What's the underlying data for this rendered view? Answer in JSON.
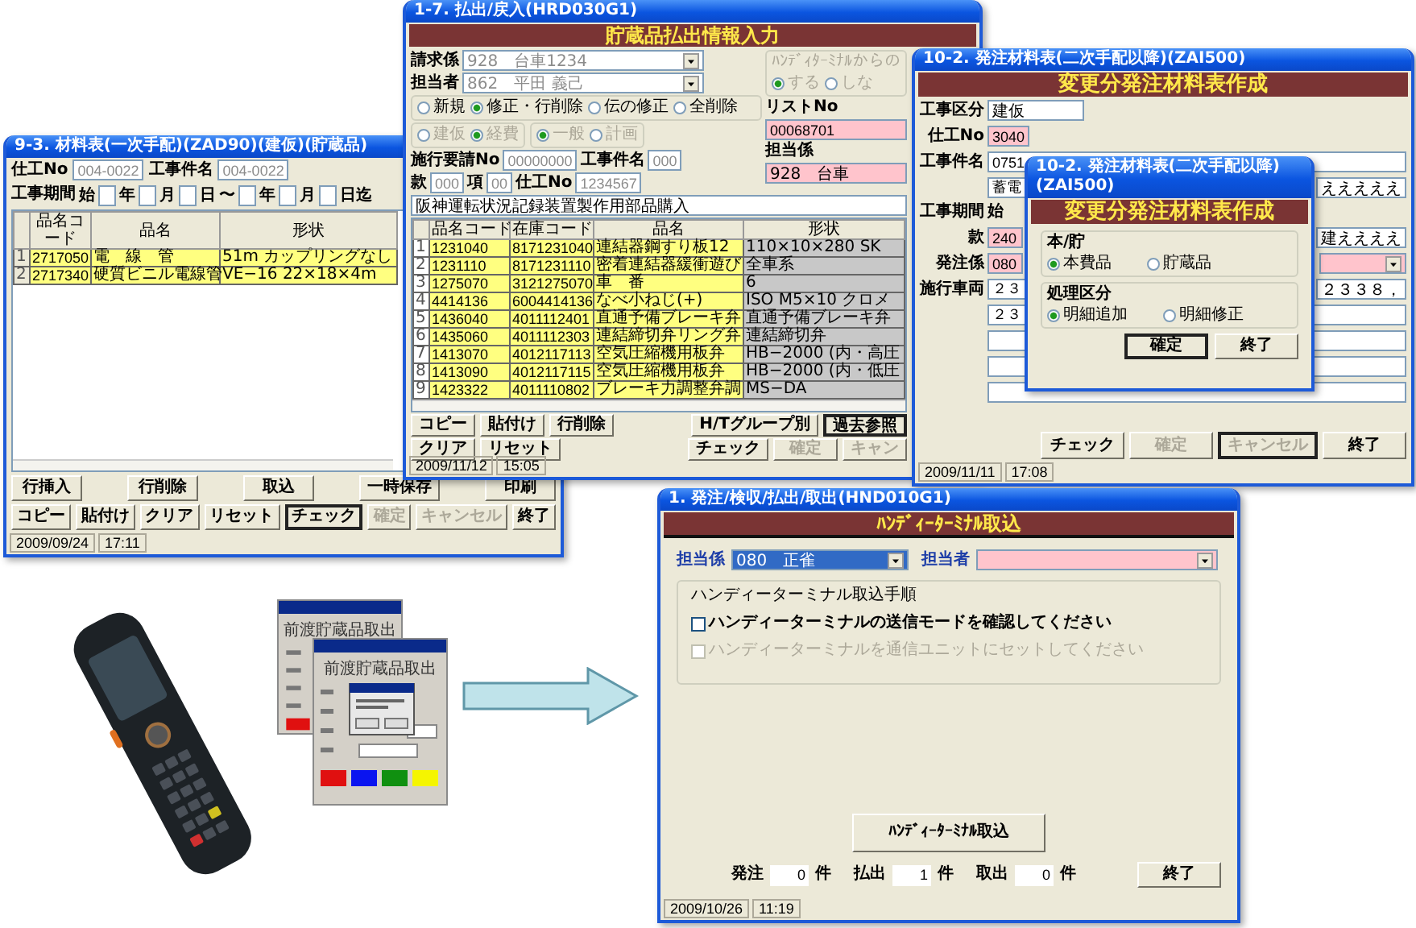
{
  "material_window": {
    "title": "9-3. 材料表(一次手配)(ZAD90)(建仮)(貯蔵品)",
    "fields": [
      {
        "label": "仕工No",
        "value": "004-0022"
      },
      {
        "label": "工事件名",
        "value": "004-0022"
      }
    ],
    "period": {
      "label": "工事期間",
      "parts": [
        {
          "kind": "text",
          "text": "始"
        },
        {
          "kind": "field"
        },
        {
          "kind": "text",
          "text": "年"
        },
        {
          "kind": "field"
        },
        {
          "kind": "text",
          "text": "月"
        },
        {
          "kind": "field"
        },
        {
          "kind": "text",
          "text": "日"
        },
        {
          "kind": "text",
          "text": "〜"
        },
        {
          "kind": "field"
        },
        {
          "kind": "text",
          "text": "年"
        },
        {
          "kind": "field"
        },
        {
          "kind": "text",
          "text": "月"
        },
        {
          "kind": "field"
        },
        {
          "kind": "text",
          "text": "日迄"
        }
      ]
    },
    "columns": [
      "",
      "品名コード",
      "品名",
      "形状"
    ],
    "rows": [
      [
        "1",
        "2717050",
        "電　線　管",
        "51m カップリングなし"
      ],
      [
        "2",
        "2717340",
        "硬質ビニル電線管",
        "VE−16 22×18×4m"
      ]
    ],
    "buttons": [
      [
        {
          "label": "行挿入",
          "disabled": false,
          "focused": false
        },
        {
          "label": "行削除",
          "disabled": false,
          "focused": false
        },
        {
          "label": "取込",
          "disabled": false,
          "focused": false
        },
        {
          "label": "一時保存",
          "disabled": false,
          "focused": false
        },
        {
          "label": "印刷",
          "disabled": false,
          "focused": false
        }
      ],
      [
        {
          "label": "コピー",
          "disabled": false,
          "focused": false
        },
        {
          "label": "貼付け",
          "disabled": false,
          "focused": false
        },
        {
          "label": "クリア",
          "disabled": false,
          "focused": false
        },
        {
          "label": "リセット",
          "disabled": false,
          "focused": false
        },
        {
          "label": "チェック",
          "disabled": false,
          "focused": true
        },
        {
          "label": "確定",
          "disabled": true,
          "focused": false
        },
        {
          "label": "キャンセル",
          "disabled": true,
          "focused": false
        },
        {
          "label": "終了",
          "disabled": false,
          "focused": false
        }
      ]
    ],
    "status": [
      "2009/09/24",
      "17:11"
    ]
  },
  "issue_window": {
    "title": "1-7. 払出/戻入(HRD030G1)",
    "banner": "貯蔵品払出情報入力",
    "requester": {
      "label": "請求係",
      "value": "928　台車1234",
      "disabled": true
    },
    "person": {
      "label": "担当者",
      "value": "862　平田 義己",
      "disabled": true
    },
    "mode_group": {
      "disabled": false,
      "options": [
        {
          "label": "新規",
          "selected": false
        },
        {
          "label": "修正・行削除",
          "selected": true
        },
        {
          "label": "伝の修正",
          "selected": false
        },
        {
          "label": "全削除",
          "selected": false
        }
      ]
    },
    "type_group": {
      "disabled": true,
      "options": [
        {
          "label": "建仮",
          "selected": false
        },
        {
          "label": "経費",
          "selected": true
        }
      ]
    },
    "plan_group": {
      "disabled": true,
      "options": [
        {
          "label": "一般",
          "selected": true
        },
        {
          "label": "計画",
          "selected": false
        }
      ]
    },
    "request_no": {
      "label": "施行要請No",
      "value": "00000000",
      "disabled": true
    },
    "job_name": {
      "label": "工事件名",
      "value": "000",
      "disabled": true
    },
    "section": {
      "label": "款",
      "value": "000",
      "disabled": true
    },
    "item": {
      "label": "項",
      "value": "00",
      "disabled": true
    },
    "job_no": {
      "label": "仕工No",
      "value": "1234567",
      "disabled": true
    },
    "description": "阪神運転状況記録装置製作用部品購入",
    "handy_group": {
      "label": "ﾊﾝﾃﾞｨﾀｰﾐﾅﾙからの",
      "disabled": true,
      "options": [
        {
          "label": "する",
          "selected": true
        },
        {
          "label": "しな",
          "selected": false
        }
      ]
    },
    "list_no": {
      "label": "リストNo",
      "value": "00068701"
    },
    "clerk": {
      "label": "担当係",
      "value": "928　台車"
    },
    "columns": [
      "",
      "品名コード",
      "在庫コード",
      "品名",
      "形状"
    ],
    "rows": [
      [
        "1",
        "1231040",
        "8171231040",
        "連結器鋼すり板12",
        "110×10×280 SK"
      ],
      [
        "2",
        "1231110",
        "8171231110",
        "密着連結器緩衝遊び",
        "全車系"
      ],
      [
        "3",
        "1275070",
        "3121275070",
        "車　番",
        "6"
      ],
      [
        "4",
        "4414136",
        "6004414136",
        "なべ小ねじ(+)",
        "ISO M5×10 クロメ"
      ],
      [
        "5",
        "1436040",
        "4011112401",
        "直通予備ブレーキ弁",
        "直通予備ブレーキ弁"
      ],
      [
        "6",
        "1435060",
        "4011112303",
        "連結締切弁リング弁",
        "連結締切弁"
      ],
      [
        "7",
        "1413070",
        "4012117113",
        "空気圧縮機用板弁",
        "HB−2000 (内・高圧"
      ],
      [
        "8",
        "1413090",
        "4012117115",
        "空気圧縮機用板弁",
        "HB−2000 (内・低圧"
      ],
      [
        "9",
        "1423322",
        "4011110802",
        "ブレーキ力調整弁調",
        "MS−DA"
      ]
    ],
    "buttons": [
      [
        {
          "label": "コピー",
          "disabled": false,
          "focused": false
        },
        {
          "label": "貼付け",
          "disabled": false,
          "focused": false
        },
        {
          "label": "行削除",
          "disabled": false,
          "focused": false
        },
        {
          "label": "H/Tグループ別",
          "disabled": false,
          "focused": false
        },
        {
          "label": "過去参照",
          "disabled": false,
          "focused": true
        }
      ],
      [
        {
          "label": "クリア",
          "disabled": false,
          "focused": false
        },
        {
          "label": "リセット",
          "disabled": false,
          "focused": false
        },
        {
          "label": "チェック",
          "disabled": false,
          "focused": false
        },
        {
          "label": "確定",
          "disabled": true,
          "focused": false
        },
        {
          "label": "キャン",
          "disabled": true,
          "focused": false
        }
      ]
    ],
    "status": [
      "2009/11/12",
      "15:05"
    ]
  },
  "order_window": {
    "title": "10-2. 発注材料表(二次手配以降)(ZAI500)",
    "banner": "変更分発注材料表作成",
    "rows": [
      {
        "label": "工事区分",
        "kind": "wide",
        "value": "建仮"
      },
      {
        "label": "仕工No",
        "kind": "pink",
        "value": "3040"
      },
      {
        "label": "工事件名",
        "kind": "field",
        "value": "0751"
      },
      {
        "kind": "field",
        "value": "蓄電",
        "right": "えええええ"
      },
      {
        "label": "工事期間",
        "kind": "text",
        "value": "始"
      },
      {
        "label": "款",
        "kind": "pink",
        "value": "240",
        "right": "建ええええ"
      },
      {
        "label": "発注係",
        "kind": "combo",
        "value": "080"
      },
      {
        "label": "施行車両",
        "kind": "field",
        "value": "２３",
        "right": "２３３８，"
      },
      {
        "kind": "field",
        "value": "２３"
      },
      {
        "kind": "field"
      },
      {
        "kind": "field"
      },
      {
        "kind": "field"
      }
    ],
    "buttons": [
      {
        "label": "チェック",
        "disabled": false,
        "focused": false
      },
      {
        "label": "確定",
        "disabled": true,
        "focused": false
      },
      {
        "label": "キャンセル",
        "disabled": true,
        "focused": true
      },
      {
        "label": "終了",
        "disabled": false,
        "focused": false
      }
    ],
    "status": [
      "2009/11/11",
      "17:08"
    ]
  },
  "order_dialog": {
    "title": "10-2. 発注材料表(二次手配以降)(ZAI500)",
    "banner": "変更分発注材料表作成",
    "groups": [
      {
        "label": "本/貯",
        "options": [
          {
            "label": "本費品",
            "selected": true
          },
          {
            "label": "貯蔵品",
            "selected": false
          }
        ]
      },
      {
        "label": "処理区分",
        "options": [
          {
            "label": "明細追加",
            "selected": true
          },
          {
            "label": "明細修正",
            "selected": false
          }
        ]
      }
    ],
    "buttons": [
      {
        "label": "確定",
        "disabled": false,
        "focused": true
      },
      {
        "label": "終了",
        "disabled": false,
        "focused": false
      }
    ]
  },
  "handy_window": {
    "title": "1. 発注/検収/払出/取出(HND010G1)",
    "banner": "ﾊﾝﾃﾞｨｰﾀｰﾐﾅﾙ取込",
    "clerk": {
      "label": "担当係",
      "value": "080　正雀",
      "focused": true
    },
    "person": {
      "label": "担当者",
      "focused": false
    },
    "steps": {
      "title": "ハンディーターミナル取込手順",
      "items": [
        {
          "label": "ハンディーターミナルの送信モードを確認してください",
          "checked": false,
          "disabled": false
        },
        {
          "label": "ハンディーターミナルを通信ユニットにセットしてください",
          "checked": false,
          "disabled": true
        }
      ]
    },
    "import_button": "ﾊﾝﾃﾞｨｰﾀｰﾐﾅﾙ取込",
    "counts": [
      {
        "label": "発注",
        "value": "0",
        "unit": "件"
      },
      {
        "label": "払出",
        "value": "1",
        "unit": "件"
      },
      {
        "label": "取出",
        "value": "0",
        "unit": "件"
      }
    ],
    "close_button": "終了",
    "status": [
      "2009/10/26",
      "11:19"
    ]
  },
  "terminal_screens": [
    {
      "heading": "前渡貯蔵品取出"
    },
    {
      "heading": "前渡貯蔵品取出"
    }
  ]
}
